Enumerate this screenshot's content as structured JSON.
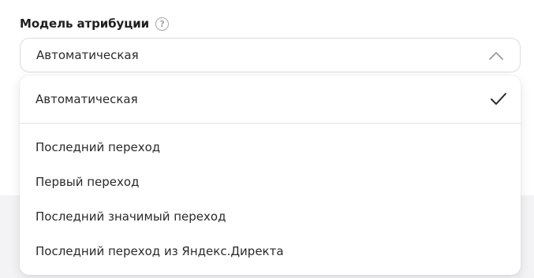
{
  "field": {
    "label": "Модель атрибуции",
    "help_icon_glyph": "?",
    "help_icon": "question-circle-icon"
  },
  "select": {
    "value": "Автоматическая",
    "icon": "chevron-up-icon",
    "expanded": true
  },
  "dropdown": {
    "selected_option": "Автоматическая",
    "selected_icon": "check-icon",
    "options": [
      "Последний переход",
      "Первый переход",
      "Последний значимый переход",
      "Последний переход из Яндекс.Директа"
    ]
  },
  "colors": {
    "text": "#2a2a2a",
    "border": "#dcdcdf",
    "help_icon": "#a6a6ab",
    "background_band": "#f3f3f5"
  }
}
